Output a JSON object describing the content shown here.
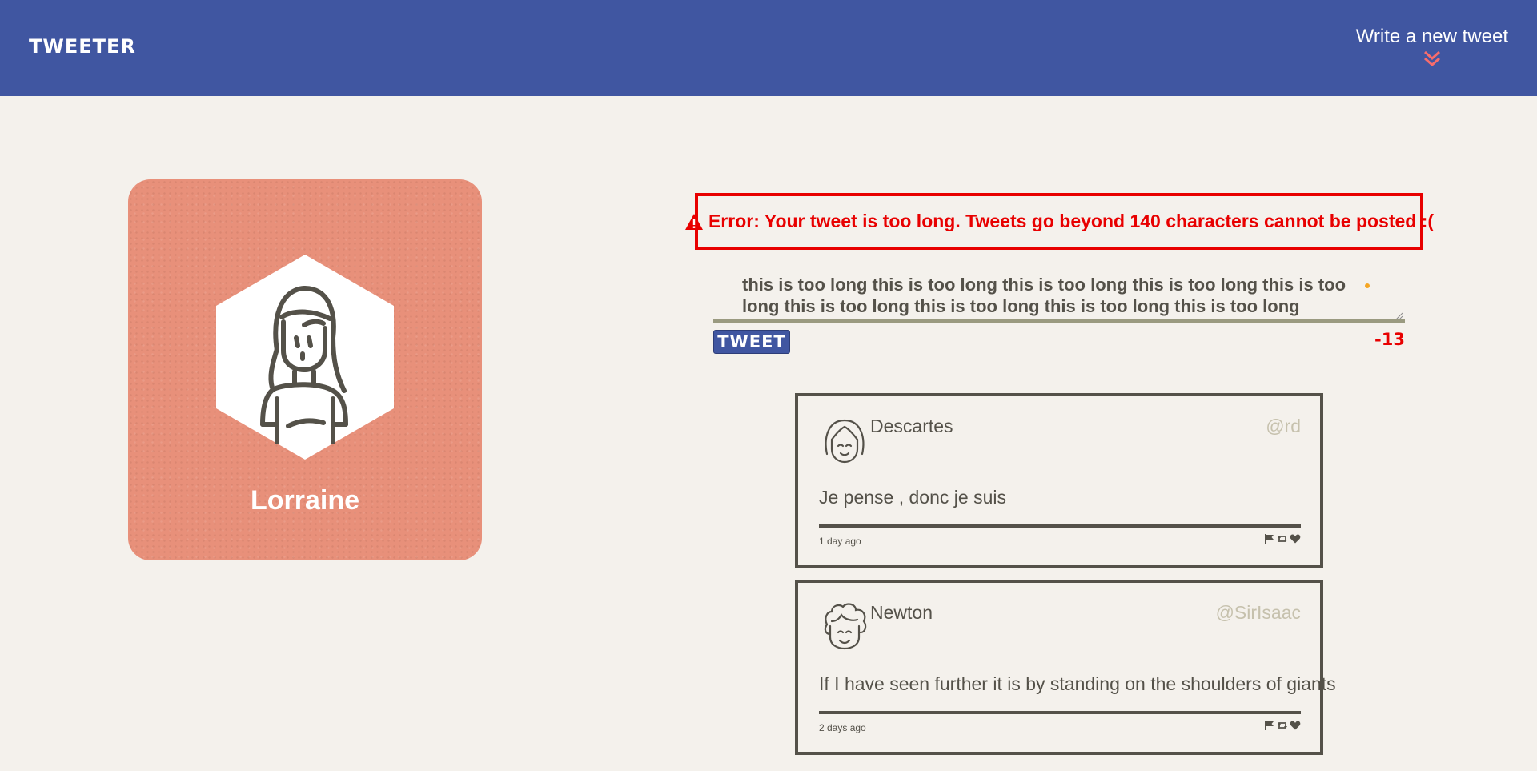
{
  "nav": {
    "brand": "Tweeter",
    "compose_label": "Write a new tweet"
  },
  "profile": {
    "name": "Lorraine"
  },
  "error": {
    "message": "Error: Your tweet is too long. Tweets go beyond 140 characters cannot be posted :("
  },
  "composer": {
    "text": "this is too long this is too long this is too long this is too long this is too long this is too long this is too long this is too long this is too long",
    "button_label": "TWEET",
    "counter": "-13"
  },
  "tweets": [
    {
      "name": "Descartes",
      "handle": "@rd",
      "content": "Je pense , donc je suis",
      "age": "1 day ago",
      "avatar": "female-avatar-icon"
    },
    {
      "name": "Newton",
      "handle": "@SirIsaac",
      "content": "If I have seen further it is by standing on the shoulders of giants",
      "age": "2 days ago",
      "avatar": "curly-hair-avatar-icon"
    }
  ],
  "icons": [
    "double-chevron-down-icon",
    "warning-icon",
    "flag-icon",
    "retweet-icon",
    "heart-icon"
  ],
  "colors": {
    "nav": "#4056a1",
    "accent": "#f76c6c",
    "profile_card": "#e8907a",
    "error": "#e80000",
    "text": "#545149",
    "background": "#f4f1ec"
  }
}
